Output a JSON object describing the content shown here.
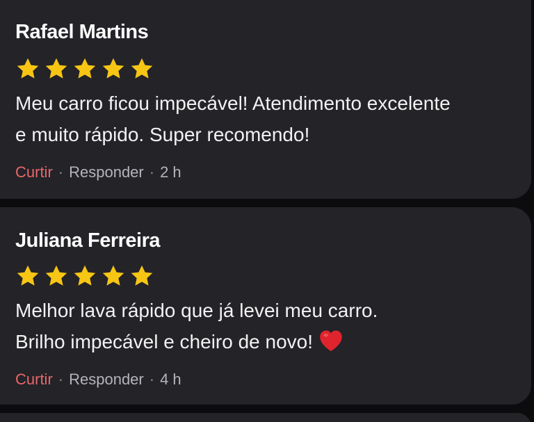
{
  "reviews": [
    {
      "author": "Rafael Martins",
      "rating": 5,
      "comment_lines": [
        "Meu carro ficou impecável! Atendimento excelente",
        "e muito rápido. Super recomendo!"
      ],
      "like_label": "Curtir",
      "reply_label": "Responder",
      "separator": "·",
      "time": "2 h"
    },
    {
      "author": "Juliana Ferreira",
      "rating": 5,
      "comment_lines": [
        "Melhor lava rápido que já levei meu carro.",
        "Brilho impecável e cheiro de novo!"
      ],
      "comment_emoji": "heart-icon",
      "like_label": "Curtir",
      "reply_label": "Responder",
      "separator": "·",
      "time": "4 h"
    }
  ],
  "colors": {
    "background": "#0c0c0e",
    "card": "#232328",
    "star": "#f7c614",
    "like": "#e8676a",
    "meta": "#b4b4ba",
    "heart": "#e0242e"
  }
}
